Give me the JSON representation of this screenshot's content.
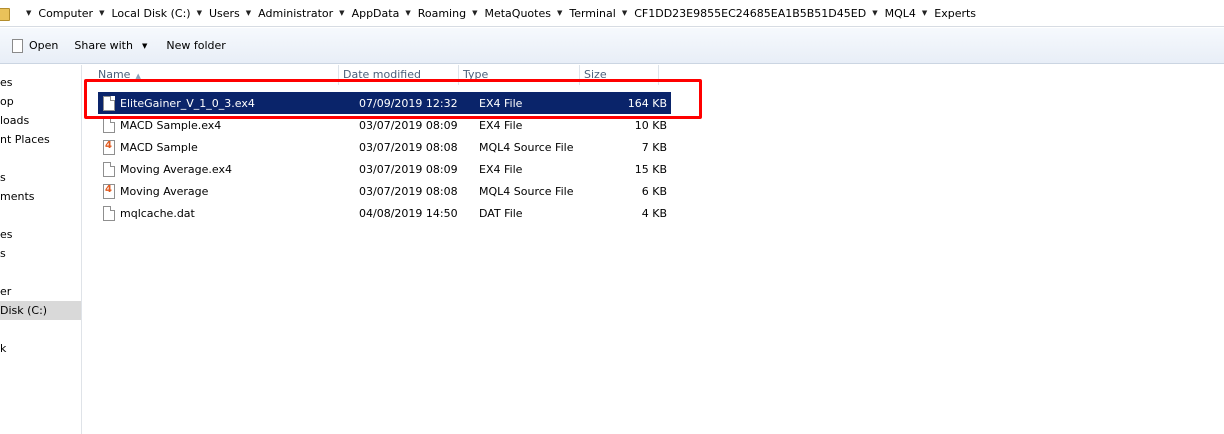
{
  "address": {
    "crumbs": [
      "Computer",
      "Local Disk (C:)",
      "Users",
      "Administrator",
      "AppData",
      "Roaming",
      "MetaQuotes",
      "Terminal",
      "CF1DD23E9855EC24685EA1B5B51D45ED",
      "MQL4",
      "Experts"
    ]
  },
  "toolbar": {
    "open_label": "Open",
    "share_label": "Share with",
    "newfolder_label": "New folder"
  },
  "nav": {
    "items": [
      "es",
      "op",
      "loads",
      "nt Places",
      "s",
      "ments",
      "es",
      "s",
      "er",
      "Disk (C:)",
      "k"
    ]
  },
  "columns": {
    "name": "Name",
    "date": "Date modified",
    "type": "Type",
    "size": "Size"
  },
  "files": [
    {
      "name": "EliteGainer_V_1_0_3.ex4",
      "date": "07/09/2019 12:32",
      "type": "EX4 File",
      "size": "164 KB",
      "icon": "blank-file-icon"
    },
    {
      "name": "MACD Sample.ex4",
      "date": "03/07/2019 08:09",
      "type": "EX4 File",
      "size": "10 KB",
      "icon": "blank-file-icon"
    },
    {
      "name": "MACD Sample",
      "date": "03/07/2019 08:08",
      "type": "MQL4 Source File",
      "size": "7 KB",
      "icon": "mql4-file-icon"
    },
    {
      "name": "Moving Average.ex4",
      "date": "03/07/2019 08:09",
      "type": "EX4 File",
      "size": "15 KB",
      "icon": "blank-file-icon"
    },
    {
      "name": "Moving Average",
      "date": "03/07/2019 08:08",
      "type": "MQL4 Source File",
      "size": "6 KB",
      "icon": "mql4-file-icon"
    },
    {
      "name": "mqlcache.dat",
      "date": "04/08/2019 14:50",
      "type": "DAT File",
      "size": "4 KB",
      "icon": "blank-file-icon"
    }
  ],
  "colors": {
    "selection": "#0a246a",
    "highlight": "#ff0000"
  }
}
